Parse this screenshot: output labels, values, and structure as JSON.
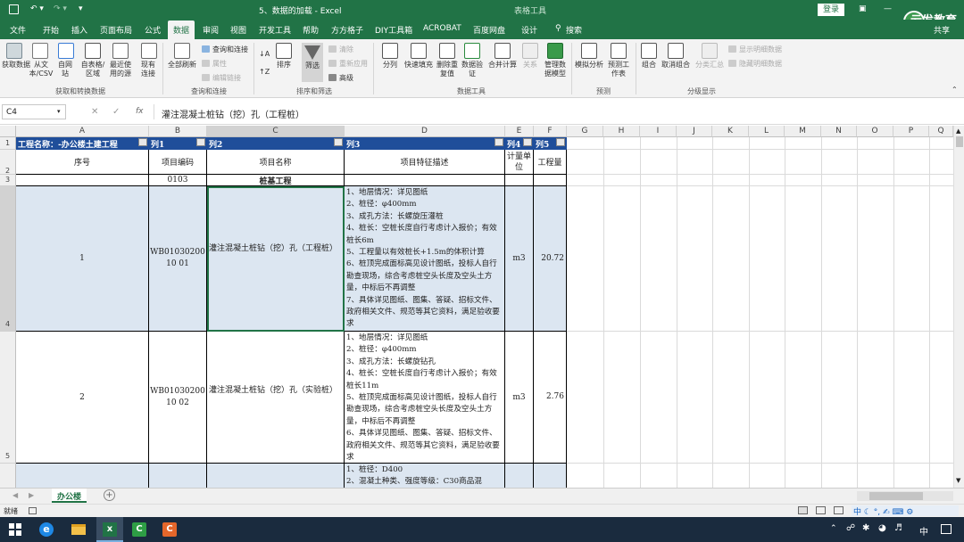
{
  "window": {
    "title": "5、数据的加载 - Excel",
    "context_tab": "表格工具",
    "login": "登录",
    "watermark": "云发教育"
  },
  "tabs": [
    "文件",
    "开始",
    "插入",
    "页面布局",
    "公式",
    "数据",
    "审阅",
    "视图",
    "开发工具",
    "帮助",
    "方方格子",
    "DIY工具箱",
    "ACROBAT",
    "百度网盘",
    "设计"
  ],
  "search": "搜索",
  "share": "共享",
  "ribbon": {
    "get_data": [
      "获取数据",
      "从文本/CSV",
      "自网站",
      "自表格/区域",
      "最近使用的源",
      "现有连接"
    ],
    "refresh_all": "全部刷新",
    "queries": [
      "查询和连接",
      "属性",
      "编辑链接"
    ],
    "sort": [
      "排序",
      "筛选"
    ],
    "filter_side": [
      "清除",
      "重新应用",
      "高级"
    ],
    "tools": [
      "分列",
      "快速填充",
      "删除重复值",
      "数据验证",
      "合并计算",
      "关系",
      "管理数据模型"
    ],
    "forecast": [
      "模拟分析",
      "预测工作表"
    ],
    "outline": [
      "组合",
      "取消组合",
      "分类汇总"
    ],
    "outline_side": [
      "显示明细数据",
      "隐藏明细数据"
    ],
    "groups": [
      "获取和转换数据",
      "查询和连接",
      "排序和筛选",
      "数据工具",
      "预测",
      "分级显示"
    ]
  },
  "formula_bar": {
    "name_box": "C4",
    "fx": "fx",
    "content": "灌注混凝土桩钻（挖）孔（工程桩）"
  },
  "columns": [
    "A",
    "B",
    "C",
    "D",
    "E",
    "F",
    "G",
    "H",
    "I",
    "J",
    "K",
    "L",
    "M",
    "N",
    "O",
    "P",
    "Q"
  ],
  "rows": {
    "r1": [
      "工程名称：-办公楼土建工程",
      "列1",
      "列2",
      "列3",
      "列4",
      "列5"
    ],
    "r2": [
      "序号",
      "项目编码",
      "项目名称",
      "项目特征描述",
      "计量单位",
      "工程量"
    ],
    "r3": [
      "0103",
      "桩基工程"
    ],
    "r4": {
      "seq": "1",
      "code": "WB0103020010 01",
      "name": "灌注混凝土桩钻（挖）孔（工程桩）",
      "features": "1、地层情况：详见图纸\n2、桩径：φ400mm\n3、成孔方法：长螺旋压灌桩\n4、桩长：空桩长度自行考虑计入报价；有效桩长6m\n5、工程量以有效桩长+1.5m的体积计算\n6、桩顶完成面标高见设计图纸，投标人自行勘查现场，综合考虑桩空头长度及空头土方量，中标后不再调整\n7、具体详见图纸、图集、答疑、招标文件、政府相关文件、规范等其它资料，满足验收要求",
      "unit": "m3",
      "qty": "20.72"
    },
    "r5": {
      "seq": "2",
      "code": "WB0103020010 02",
      "name": "灌注混凝土桩钻（挖）孔（实验桩）",
      "features": "1、地层情况：详见图纸\n2、桩径：φ400mm\n3、成孔方法：长螺旋钻孔\n4、桩长：空桩长度自行考虑计入报价；有效桩长11m\n5、桩顶完成面标高见设计图纸，投标人自行勘查现场，综合考虑桩空头长度及空头土方量，中标后不再调整\n6、具体详见图纸、图集、答疑、招标文件、政府相关文件、规范等其它资料，满足验收要求",
      "unit": "m3",
      "qty": "2.76"
    },
    "r6": {
      "features": "1、桩径：D400\n2、混凝土种类、强度等级：C30商品混"
    }
  },
  "row_numbers": [
    "1",
    "2",
    "3",
    "4",
    "5"
  ],
  "sheet_tab": "办公楼",
  "status": "就绪",
  "taskbar": {
    "ime": "中",
    "ime2": "中"
  }
}
